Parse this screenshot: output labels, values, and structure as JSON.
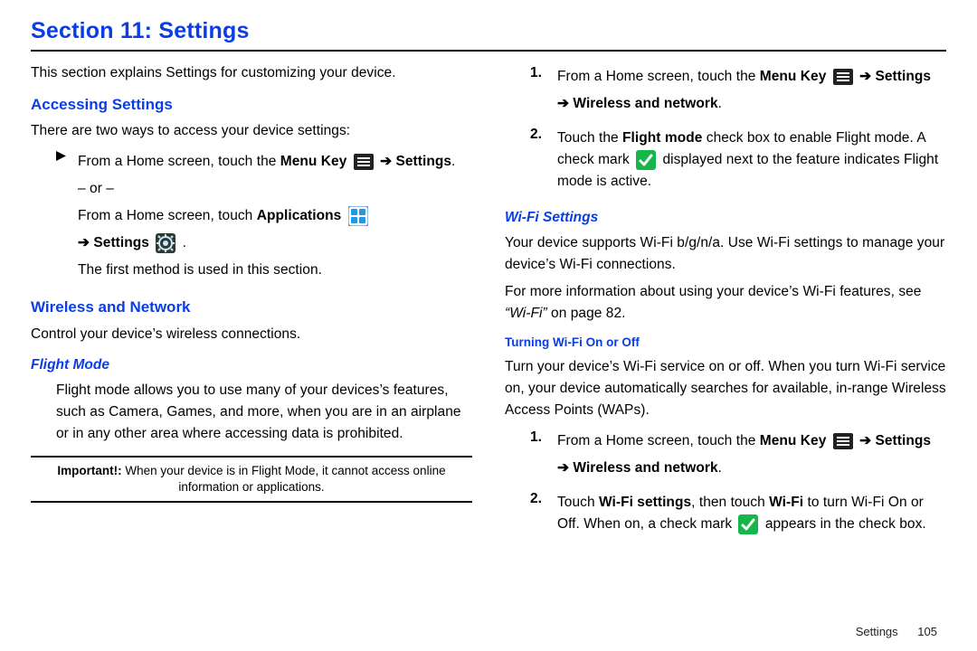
{
  "title": "Section 11: Settings",
  "left": {
    "intro": "This section explains Settings for customizing your device.",
    "h_accessing": "Accessing Settings",
    "accessing_intro": "There are two ways to access your device settings:",
    "step1_part1": "From a Home screen, touch the ",
    "step1_menukey": "Menu Key",
    "step1_arrow": " ➔ ",
    "step1_settings": "Settings",
    "step1_end": ".",
    "or_line": "– or –",
    "step2_part1": "From a Home screen, touch ",
    "step2_apps": "Applications",
    "step2b_arrow": "➔ ",
    "step2b_settings": "Settings",
    "step2b_end": " .",
    "first_method": "The first method is used in this section.",
    "h_wireless": "Wireless and Network",
    "wireless_intro": "Control your device’s wireless connections.",
    "h_flight": "Flight Mode",
    "flight_body": "Flight mode allows you to use many of your devices’s features, such as Camera, Games, and more, when you are in an airplane or in any other area where accessing data is prohibited.",
    "important_lab": "Important!:",
    "important_body": " When your device is in Flight Mode, it cannot access online information or applications."
  },
  "right": {
    "s1_num": "1.",
    "s1_part1": "From a Home screen, touch the ",
    "s1_menukey": "Menu Key",
    "s1_arrow": " ➔ ",
    "s1_settings": "Settings",
    "s1_line2a": "➔ ",
    "s1_line2b": "Wireless and network",
    "s1_line2c": ".",
    "s2_num": "2.",
    "s2_part1": "Touch the ",
    "s2_flight": "Flight mode",
    "s2_part2": " check box to enable Flight mode. A check mark ",
    "s2_part3": " displayed next to the feature indicates Flight mode is active.",
    "h_wifi": "Wi-Fi Settings",
    "wifi_p1": "Your device supports Wi-Fi b/g/n/a. Use Wi-Fi settings to manage your device’s Wi-Fi connections.",
    "wifi_p2a": "For more information about using your device’s Wi-Fi features, see ",
    "wifi_p2b": "“Wi-Fi”",
    "wifi_p2c": " on page 82.",
    "h_turning": "Turning Wi-Fi On or Off",
    "turning_p1": "Turn your device’s Wi-Fi service on or off. When you turn Wi-Fi service on, your device automatically searches for available, in-range Wireless Access Points (WAPs).",
    "t1_num": "1.",
    "t1_part1": "From a Home screen, touch the ",
    "t1_menukey": "Menu Key",
    "t1_arrow": " ➔ ",
    "t1_settings": "Settings",
    "t1_line2a": "➔ ",
    "t1_line2b": "Wireless and network",
    "t1_line2c": ".",
    "t2_num": "2.",
    "t2_part1": "Touch ",
    "t2_wfs": "Wi-Fi settings",
    "t2_part2": ", then touch ",
    "t2_wf": "Wi-Fi",
    "t2_part3": " to turn Wi-Fi On or Off. When on, a check mark ",
    "t2_part4": " appears in the check box."
  },
  "footer": {
    "name": "Settings",
    "page": "105"
  }
}
